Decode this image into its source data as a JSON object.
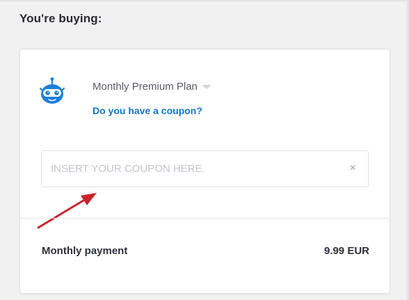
{
  "heading": "You're buying:",
  "plan": {
    "name": "Monthly Premium Plan"
  },
  "coupon": {
    "link_label": "Do you have a coupon?",
    "placeholder": "INSERT YOUR COUPON HERE.",
    "value": "",
    "clear_symbol": "×"
  },
  "payment": {
    "label": "Monthly payment",
    "amount": "9.99 EUR"
  },
  "icons": {
    "logo": "robot-mascot-icon",
    "plan_dropdown": "caret-down-icon",
    "clear": "close-icon",
    "annotation": "red-arrow-icon"
  },
  "colors": {
    "link": "#1077c9",
    "logo": "#1c7fd8",
    "annotation_arrow": "#c7242b",
    "text_dark": "#2f3039",
    "page_bg": "#f1f1f2"
  }
}
